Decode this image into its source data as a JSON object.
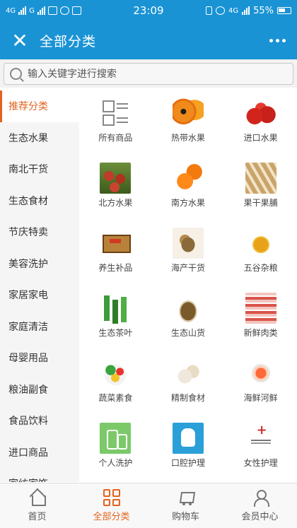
{
  "status_bar": {
    "net_left": "4G",
    "net_mid": "G",
    "time": "23:09",
    "net_right": "4G",
    "battery": "55%"
  },
  "header": {
    "title": "全部分类"
  },
  "search": {
    "placeholder": "输入关键字进行搜索"
  },
  "sidebar": {
    "items": [
      {
        "label": "推荐分类",
        "active": true
      },
      {
        "label": "生态水果"
      },
      {
        "label": "南北干货"
      },
      {
        "label": "生态食材"
      },
      {
        "label": "节庆特卖"
      },
      {
        "label": "美容洗护"
      },
      {
        "label": "家居家电"
      },
      {
        "label": "家庭清洁"
      },
      {
        "label": "母婴用品"
      },
      {
        "label": "粮油副食"
      },
      {
        "label": "食品饮料"
      },
      {
        "label": "进口商品"
      },
      {
        "label": "家纺家饰"
      }
    ]
  },
  "grid": {
    "items": [
      {
        "label": "所有商品",
        "icon": "all-products-icon"
      },
      {
        "label": "热带水果",
        "icon": "tropical-fruit-image"
      },
      {
        "label": "进口水果",
        "icon": "imported-fruit-image"
      },
      {
        "label": "北方水果",
        "icon": "northern-fruit-image"
      },
      {
        "label": "南方水果",
        "icon": "southern-fruit-image"
      },
      {
        "label": "果干果脯",
        "icon": "dried-fruit-image"
      },
      {
        "label": "养生补品",
        "icon": "health-supplement-image"
      },
      {
        "label": "海产干货",
        "icon": "dried-seafood-image"
      },
      {
        "label": "五谷杂粮",
        "icon": "grains-image"
      },
      {
        "label": "生态茶叶",
        "icon": "tea-image"
      },
      {
        "label": "生态山货",
        "icon": "mountain-goods-image"
      },
      {
        "label": "新鲜肉类",
        "icon": "fresh-meat-image"
      },
      {
        "label": "蔬菜素食",
        "icon": "vegetables-image"
      },
      {
        "label": "精制食材",
        "icon": "refined-ingredients-image"
      },
      {
        "label": "海鲜河鲜",
        "icon": "seafood-image"
      },
      {
        "label": "个人洗护",
        "icon": "personal-care-image"
      },
      {
        "label": "口腔护理",
        "icon": "oral-care-image"
      },
      {
        "label": "女性护理",
        "icon": "feminine-care-image"
      }
    ]
  },
  "tabbar": {
    "tabs": [
      {
        "label": "首页",
        "icon": "home-icon"
      },
      {
        "label": "全部分类",
        "icon": "category-icon",
        "active": true
      },
      {
        "label": "购物车",
        "icon": "cart-icon"
      },
      {
        "label": "会员中心",
        "icon": "user-icon"
      }
    ]
  },
  "colors": {
    "header_bg": "#1a93d4",
    "accent": "#e3631d"
  }
}
